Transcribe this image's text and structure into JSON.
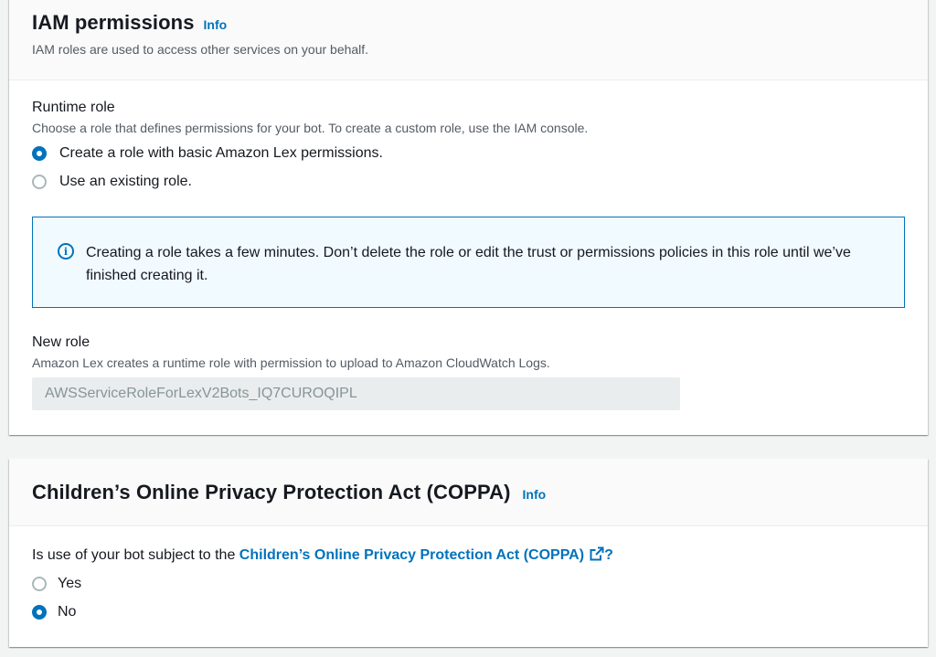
{
  "iam": {
    "title": "IAM permissions",
    "info": "Info",
    "description": "IAM roles are used to access other services on your behalf.",
    "runtime_role": {
      "label": "Runtime role",
      "description": "Choose a role that defines permissions for your bot. To create a custom role, use the IAM console.",
      "options": [
        {
          "label": "Create a role with basic Amazon Lex permissions.",
          "checked": true
        },
        {
          "label": "Use an existing role.",
          "checked": false
        }
      ]
    },
    "alert": {
      "icon": "info-icon",
      "text": "Creating a role takes a few minutes. Don’t delete the role or edit the trust or permissions policies in this role until we’ve finished creating it."
    },
    "new_role": {
      "label": "New role",
      "description": "Amazon Lex creates a runtime role with permission to upload to Amazon CloudWatch Logs.",
      "value": "AWSServiceRoleForLexV2Bots_IQ7CUROQIPL"
    }
  },
  "coppa": {
    "title": "Children’s Online Privacy Protection Act (COPPA)",
    "info": "Info",
    "question_prefix": "Is use of your bot subject to the ",
    "question_link": "Children’s Online Privacy Protection Act (COPPA)",
    "question_suffix": "?",
    "options": [
      {
        "label": "Yes",
        "checked": false
      },
      {
        "label": "No",
        "checked": true
      }
    ]
  },
  "colors": {
    "accent": "#0073bb",
    "page_bg": "#f2f3f3",
    "alert_bg": "#f1faff"
  }
}
